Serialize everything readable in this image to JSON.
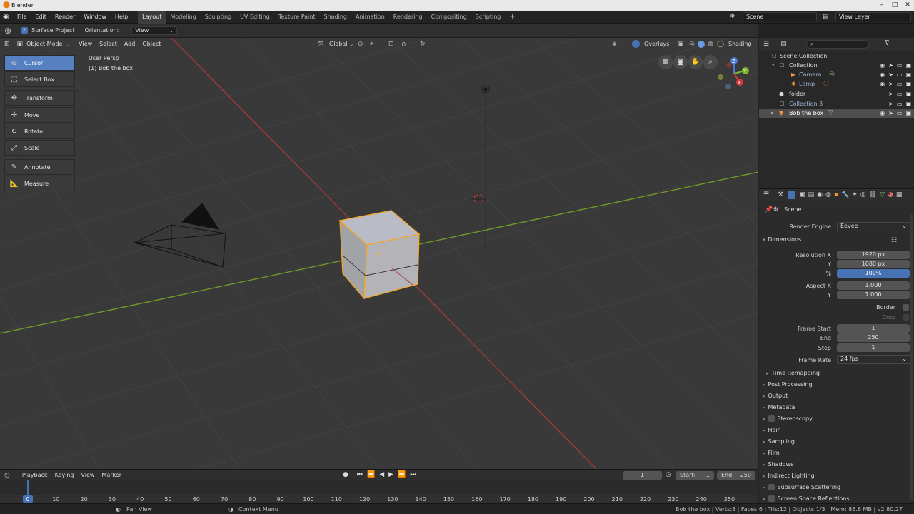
{
  "window": {
    "title": "Blender"
  },
  "menubar": {
    "menus": [
      "File",
      "Edit",
      "Render",
      "Window",
      "Help"
    ],
    "workspaces": [
      "Layout",
      "Modeling",
      "Sculpting",
      "UV Editing",
      "Texture Paint",
      "Shading",
      "Animation",
      "Rendering",
      "Compositing",
      "Scripting"
    ],
    "active_workspace": "Layout",
    "scene_name": "Scene",
    "view_layer": "View Layer"
  },
  "tool_settings": {
    "surface_project_label": "Surface Project",
    "surface_project_checked": true,
    "orientation_label": "Orientation:",
    "orientation_value": "View"
  },
  "viewport_header": {
    "mode": "Object Mode",
    "menus": [
      "View",
      "Select",
      "Add",
      "Object"
    ],
    "transform_orientation": "Global",
    "overlays_label": "Overlays",
    "shading_label": "Shading"
  },
  "viewport": {
    "view_name": "User Persp",
    "active_object": "(1) Bob the box"
  },
  "toolbar": {
    "tools": [
      {
        "label": "Cursor",
        "icon": "cursor-icon",
        "active": true
      },
      {
        "label": "Select Box",
        "icon": "select-box-icon",
        "active": false
      },
      {
        "label": "Transform",
        "icon": "transform-icon",
        "active": false
      },
      {
        "label": "Move",
        "icon": "move-icon",
        "active": false
      },
      {
        "label": "Rotate",
        "icon": "rotate-icon",
        "active": false
      },
      {
        "label": "Scale",
        "icon": "scale-icon",
        "active": false
      },
      {
        "label": "Annotate",
        "icon": "annotate-icon",
        "active": false
      },
      {
        "label": "Measure",
        "icon": "measure-icon",
        "active": false
      }
    ]
  },
  "outliner": {
    "items": [
      {
        "label": "Scene Collection",
        "indent": 0
      },
      {
        "label": "Collection",
        "indent": 1
      },
      {
        "label": "Camera",
        "indent": 2
      },
      {
        "label": "Lamp",
        "indent": 2
      },
      {
        "label": "folder",
        "indent": 1
      },
      {
        "label": "Collection 3",
        "indent": 1
      },
      {
        "label": "Bob the box",
        "indent": 1,
        "selected": true
      }
    ]
  },
  "properties": {
    "context": "Scene",
    "render_engine_label": "Render Engine",
    "render_engine_value": "Eevee",
    "dimensions_title": "Dimensions",
    "resolution_x_label": "Resolution X",
    "resolution_x": "1920 px",
    "resolution_y_label": "Y",
    "resolution_y": "1080 px",
    "resolution_pct_label": "%",
    "resolution_pct": "100%",
    "aspect_x_label": "Aspect X",
    "aspect_x": "1.000",
    "aspect_y_label": "Y",
    "aspect_y": "1.000",
    "border_label": "Border",
    "crop_label": "Crop",
    "frame_start_label": "Frame Start",
    "frame_start": "1",
    "frame_end_label": "End",
    "frame_end": "250",
    "frame_step_label": "Step",
    "frame_step": "1",
    "frame_rate_label": "Frame Rate",
    "frame_rate": "24 fps",
    "time_remapping": "Time Remapping",
    "panels": [
      "Post Processing",
      "Output",
      "Metadata",
      "Stereoscopy",
      "Hair",
      "Sampling",
      "Film",
      "Shadows",
      "Indirect Lighting",
      "Subsurface Scattering",
      "Screen Space Reflections"
    ]
  },
  "timeline": {
    "menus": [
      "Playback",
      "Keying",
      "View",
      "Marker"
    ],
    "current_frame": "1",
    "start_label": "Start:",
    "start": "1",
    "end_label": "End:",
    "end": "250",
    "ticks": [
      "0",
      "10",
      "20",
      "30",
      "40",
      "50",
      "60",
      "70",
      "80",
      "90",
      "100",
      "110",
      "120",
      "130",
      "140",
      "150",
      "160",
      "170",
      "180",
      "190",
      "200",
      "210",
      "220",
      "230",
      "240",
      "250"
    ]
  },
  "statusbar": {
    "left_hint": "Pan View",
    "mid_hint": "Context Menu",
    "stats": "Bob the box | Verts:8 | Faces:6 | Tris:12 | Objects:1/3 | Mem: 85.6 MB | v2.80.27"
  },
  "colors": {
    "accent": "#4772b3",
    "x_axis": "#b33a3a",
    "y_axis": "#6a9a2b",
    "selection_outline": "#f5a623"
  }
}
